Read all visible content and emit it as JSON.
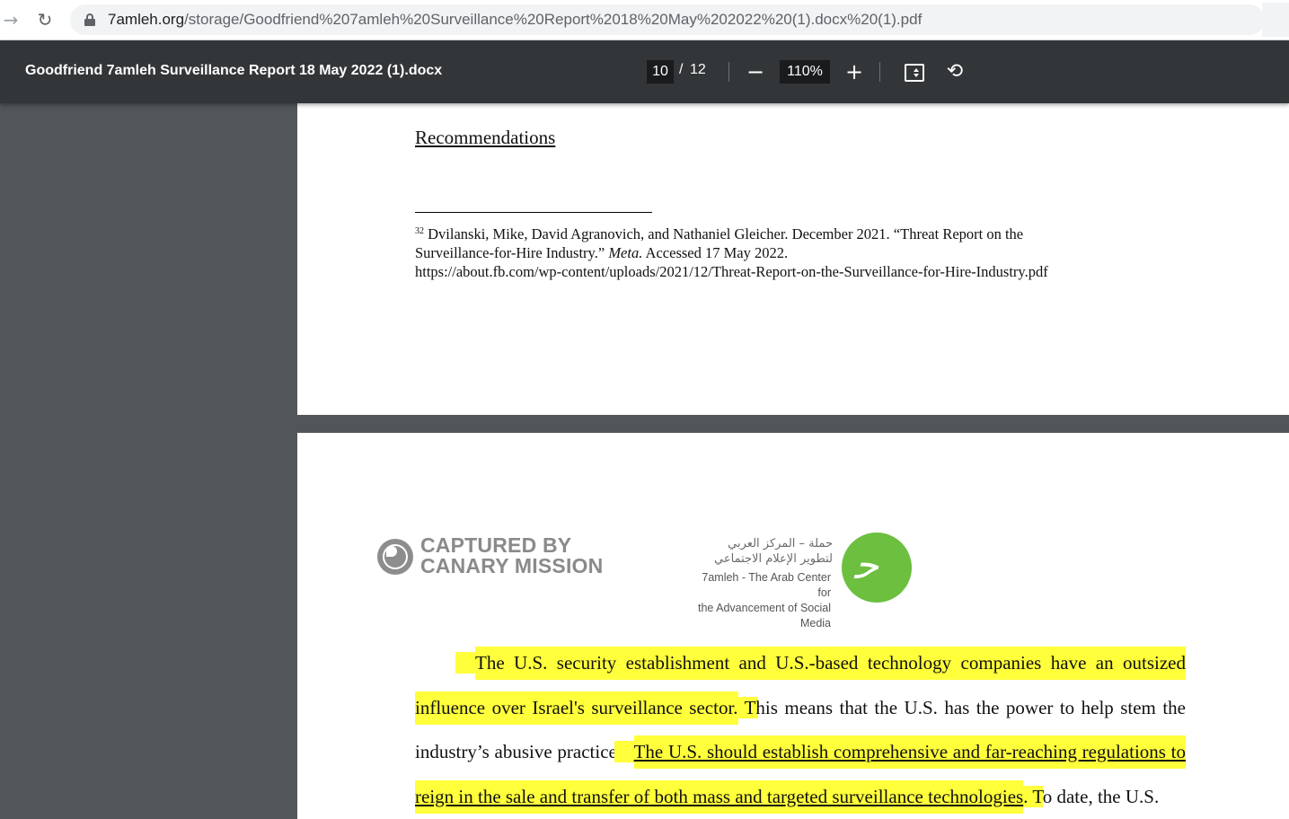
{
  "browser": {
    "url_host": "7amleh.org",
    "url_path": "/storage/Goodfriend%207amleh%20Surveillance%20Report%2018%20May%202022%20(1).docx%20(1).pdf",
    "forward_icon": "arrow-right-icon",
    "reload_icon": "reload-icon",
    "lock_icon": "lock-icon"
  },
  "viewer": {
    "title": "Goodfriend 7amleh Surveillance Report 18 May 2022 (1).docx",
    "current_page": "10",
    "page_separator": "/",
    "total_pages": "12",
    "zoom": "110%",
    "zoom_out_symbol": "−",
    "zoom_in_symbol": "+",
    "rotate_symbol": "⟲"
  },
  "page10": {
    "heading": "Recommendations",
    "footnote_number": "32",
    "footnote_line1": "Dvilanski, Mike, David Agranovich, and Nathaniel Gleicher. December 2021. “Threat Report on the",
    "footnote_line2_a": "Surveillance-for-Hire Industry.” ",
    "footnote_line2_italic": "Meta.",
    "footnote_line2_b": " Accessed 17 May 2022.",
    "footnote_line3": "https://about.fb.com/wp-content/uploads/2021/12/Threat-Report-on-the-Surveillance-for-Hire-Industry.pdf"
  },
  "page11": {
    "watermark_line1": "CAPTURED BY",
    "watermark_line2": "CANARY MISSION",
    "arabic_line1": "حملة – المركز العربي",
    "arabic_line2": "لتطوير الإعلام الاجتماعي",
    "org_line1": "7amleh - The Arab Center for",
    "org_line2": "the Advancement of Social Media",
    "para_highlight_1": "The U.S. security establishment and U.S.-based technology companies have an outsized influence over Israel's surveillance sector.",
    "para_plain_1": " This means that the U.S. has the power to help stem the industry’s abusive practices. ",
    "para_highlight_2": "The U.S. should establish comprehensive and far-reaching regulations to reign in the sale and transfer of both mass and targeted surveillance technologies",
    "para_plain_2": ". To date, the U.S."
  },
  "colors": {
    "highlight": "#ffff3b",
    "toolbar": "#323639",
    "viewer_bg": "#525659",
    "logo_green": "#6cbf3f"
  }
}
